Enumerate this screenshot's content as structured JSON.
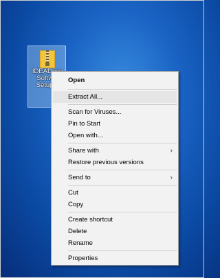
{
  "desktop": {
    "file_label": "IDEADrive\nSoftw...\nSetup..."
  },
  "context_menu": {
    "items": [
      {
        "label": "Open"
      },
      {
        "label": "Extract All..."
      },
      {
        "label": "Scan for Viruses..."
      },
      {
        "label": "Pin to Start"
      },
      {
        "label": "Open with..."
      },
      {
        "label": "Share with"
      },
      {
        "label": "Restore previous versions"
      },
      {
        "label": "Send to"
      },
      {
        "label": "Cut"
      },
      {
        "label": "Copy"
      },
      {
        "label": "Create shortcut"
      },
      {
        "label": "Delete"
      },
      {
        "label": "Rename"
      },
      {
        "label": "Properties"
      }
    ],
    "submenu_arrow": "›"
  },
  "colors": {
    "menu_background": "#f2f2f2",
    "highlight": "#e5e5e5",
    "desktop_blue": "#1a63c4"
  },
  "icons": {
    "file_icon": "zip-folder-icon"
  }
}
